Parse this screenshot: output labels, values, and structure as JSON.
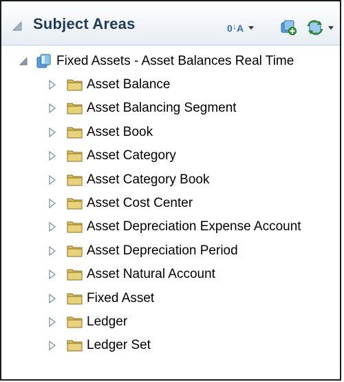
{
  "panel": {
    "title": "Subject Areas",
    "toolbar": {
      "sort_icon": "sort-icon",
      "add_icon": "add-subject-area-icon",
      "refresh_icon": "refresh-icon"
    }
  },
  "tree": {
    "root": {
      "label": "Fixed Assets - Asset Balances Real Time",
      "icon": "subject-area-icon",
      "expanded": true
    },
    "folders": [
      {
        "label": "Asset Balance"
      },
      {
        "label": "Asset Balancing Segment"
      },
      {
        "label": "Asset Book"
      },
      {
        "label": "Asset Category"
      },
      {
        "label": "Asset Category Book"
      },
      {
        "label": "Asset Cost Center"
      },
      {
        "label": "Asset Depreciation Expense Account"
      },
      {
        "label": "Asset Depreciation Period"
      },
      {
        "label": "Asset Natural Account"
      },
      {
        "label": "Fixed Asset"
      },
      {
        "label": "Ledger"
      },
      {
        "label": "Ledger Set"
      }
    ]
  },
  "colors": {
    "title": "#1f3a5a",
    "folder_fill": "#e8d37a",
    "folder_stroke": "#8a6d1e",
    "expander": "#7a8b9c",
    "cube": "#3b8ed6"
  }
}
